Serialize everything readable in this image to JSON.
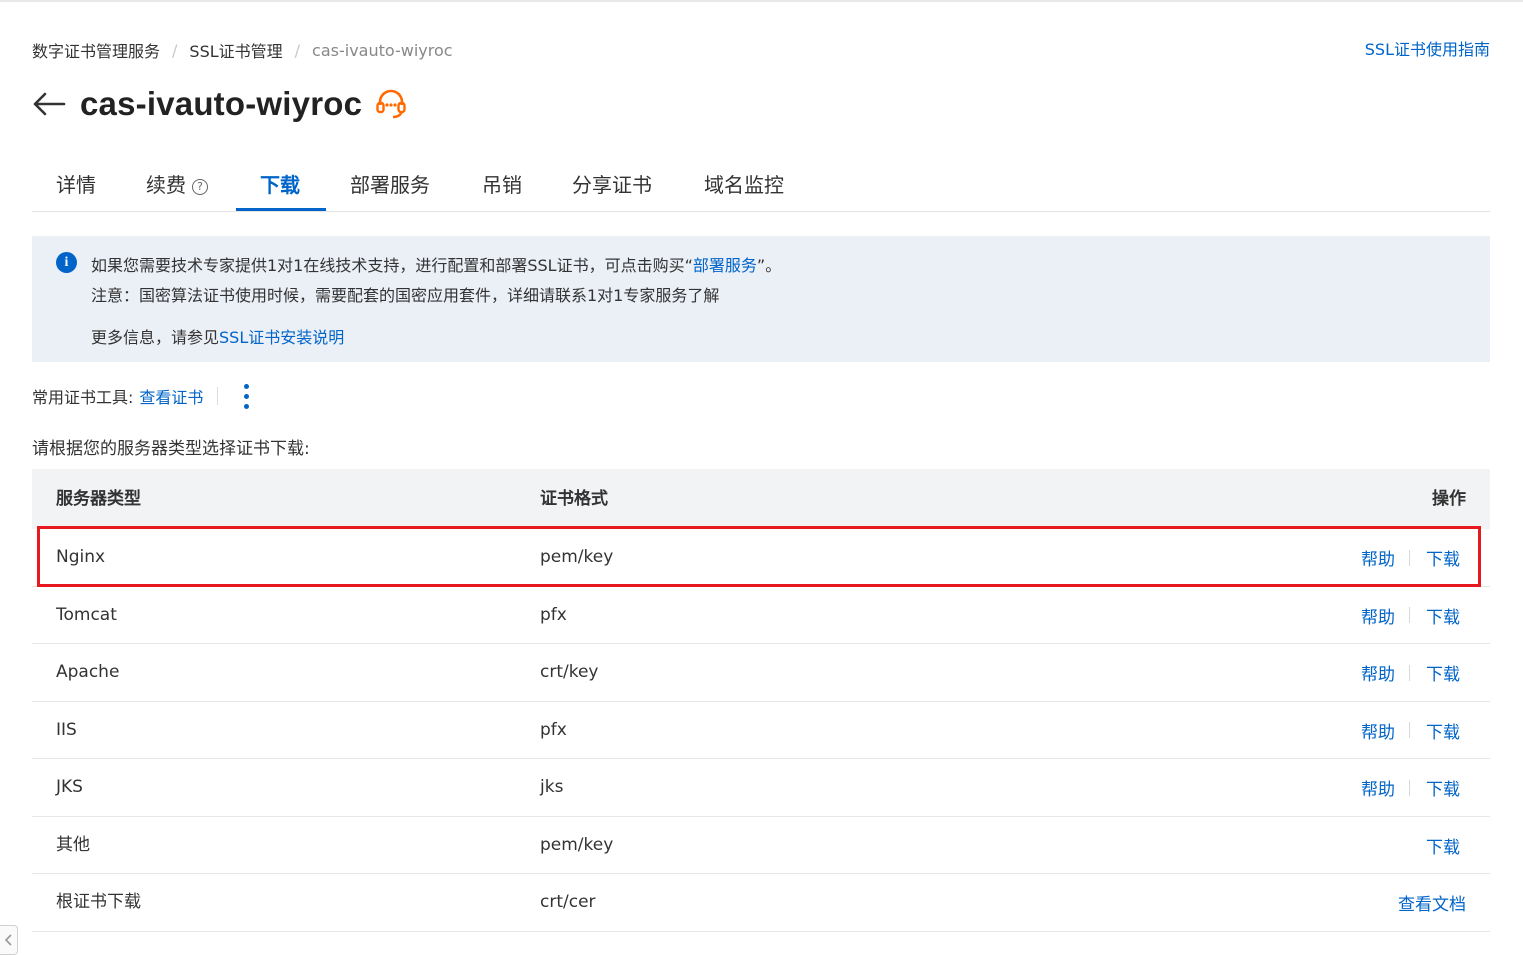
{
  "breadcrumb": {
    "items": [
      "数字证书管理服务",
      "SSL证书管理",
      "cas-ivauto-wiyroc"
    ],
    "separator": "/"
  },
  "header": {
    "guide_link": "SSL证书使用指南",
    "title": "cas-ivauto-wiyroc"
  },
  "tabs": [
    {
      "label": "详情"
    },
    {
      "label": "续费"
    },
    {
      "label": "下载"
    },
    {
      "label": "部署服务"
    },
    {
      "label": "吊销"
    },
    {
      "label": "分享证书"
    },
    {
      "label": "域名监控"
    }
  ],
  "notice": {
    "line1_prefix": "如果您需要技术专家提供1对1在线技术支持，进行配置和部署SSL证书，可点击购买“",
    "line1_link": "部署服务",
    "line1_suffix": "”。",
    "line2": "注意：国密算法证书使用时候，需要配套的国密应用套件，详细请联系1对1专家服务了解",
    "line3_prefix": "更多信息，请参见",
    "line3_link": "SSL证书安装说明"
  },
  "tools": {
    "label": "常用证书工具:",
    "link": "查看证书"
  },
  "instruction": "请根据您的服务器类型选择证书下载:",
  "table": {
    "headers": [
      "服务器类型",
      "证书格式",
      "操作"
    ],
    "rows": [
      {
        "server": "Nginx",
        "format": "pem/key",
        "help": "帮助",
        "action": "下载"
      },
      {
        "server": "Tomcat",
        "format": "pfx",
        "help": "帮助",
        "action": "下载"
      },
      {
        "server": "Apache",
        "format": "crt/key",
        "help": "帮助",
        "action": "下载"
      },
      {
        "server": "IIS",
        "format": "pfx",
        "help": "帮助",
        "action": "下载"
      },
      {
        "server": "JKS",
        "format": "jks",
        "help": "帮助",
        "action": "下载"
      },
      {
        "server": "其他",
        "format": "pem/key",
        "action": "下载"
      },
      {
        "server": "根证书下载",
        "format": "crt/cer",
        "action": "查看文档"
      }
    ]
  },
  "colors": {
    "accent": "#0064c8",
    "highlight": "#e8191e",
    "support_icon": "#ff6a00",
    "notice_bg": "#ebeff6"
  },
  "icons": {
    "back": "back-arrow-icon",
    "support": "headset-icon",
    "info": "info-icon",
    "help": "question-circle-icon",
    "more": "more-vertical-icon",
    "scroll": "chevron-left-icon"
  }
}
